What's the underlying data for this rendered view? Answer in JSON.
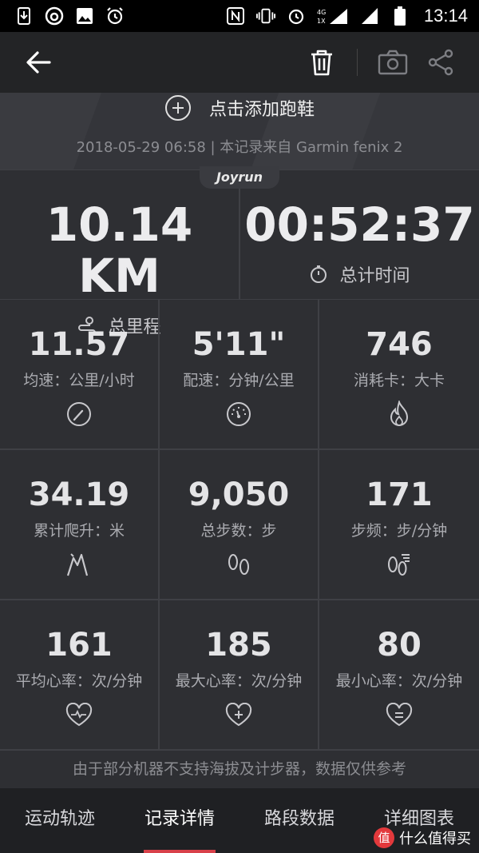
{
  "status_bar": {
    "time": "13:14",
    "network": "4G 1X"
  },
  "banner": {
    "add_shoe": "点击添加跑鞋",
    "record_source": "2018-05-29 06:58 | 本记录来自 Garmin fenix 2"
  },
  "brand_tag": "Joyrun",
  "summary": [
    {
      "value": "10.14 KM",
      "label": "总里程",
      "icon": "route-icon"
    },
    {
      "value": "00:52:37",
      "label": "总计时间",
      "icon": "stopwatch-icon"
    }
  ],
  "stats": [
    {
      "value": "11.57",
      "label": "均速：公里/小时",
      "icon": "speedometer-icon"
    },
    {
      "value": "5'11\"",
      "label": "配速：分钟/公里",
      "icon": "pace-gauge-icon"
    },
    {
      "value": "746",
      "label": "消耗卡：大卡",
      "icon": "flame-icon"
    },
    {
      "value": "34.19",
      "label": "累计爬升：米",
      "icon": "mountain-icon"
    },
    {
      "value": "9,050",
      "label": "总步数：步",
      "icon": "footprints-icon"
    },
    {
      "value": "171",
      "label": "步频：步/分钟",
      "icon": "cadence-icon"
    },
    {
      "value": "161",
      "label": "平均心率：次/分钟",
      "icon": "heart-pulse-icon"
    },
    {
      "value": "185",
      "label": "最大心率：次/分钟",
      "icon": "heart-plus-icon"
    },
    {
      "value": "80",
      "label": "最小心率：次/分钟",
      "icon": "heart-minus-icon"
    }
  ],
  "disclaimer": "由于部分机器不支持海拔及计步器，数据仅供参考",
  "tabs": [
    {
      "label": "运动轨迹"
    },
    {
      "label": "记录详情"
    },
    {
      "label": "路段数据"
    },
    {
      "label": "详细图表"
    }
  ],
  "watermark": {
    "badge": "值",
    "text": "什么值得买"
  },
  "colors": {
    "accent": "#d8414a",
    "background": "#2e2f33",
    "appbar": "#232426"
  }
}
